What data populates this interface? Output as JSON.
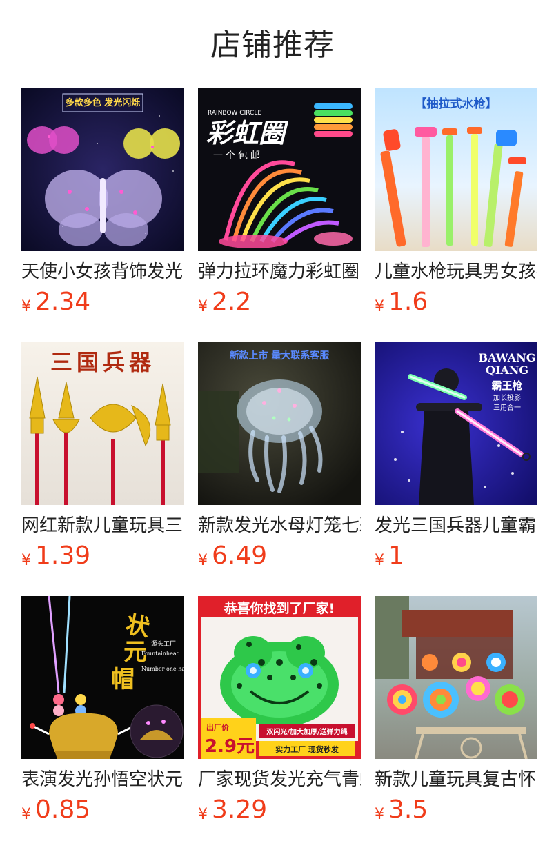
{
  "section": {
    "title": "店铺推荐"
  },
  "currency_symbol": "¥",
  "products": [
    {
      "title": "天使小女孩背饰发光蝴蝶翅膀",
      "price": "2.34",
      "image": {
        "icon": "butterfly-wings-image",
        "overlay_texts": [
          "多款多色 发光闪烁"
        ]
      }
    },
    {
      "title": "弹力拉环魔力彩虹圈",
      "price": "2.2",
      "image": {
        "icon": "rainbow-spring-image",
        "overlay_texts": [
          "RAINBOW CIRCLE",
          "彩虹圈",
          "一个包邮"
        ]
      }
    },
    {
      "title": "儿童水枪玩具男女孩抽拉式",
      "price": "1.6",
      "image": {
        "icon": "water-gun-image",
        "overlay_texts": [
          "【抽拉式水枪】"
        ]
      }
    },
    {
      "title": "网红新款儿童玩具三国兵器",
      "price": "1.39",
      "image": {
        "icon": "golden-weapons-image",
        "overlay_texts": [
          "三国兵器"
        ]
      }
    },
    {
      "title": "新款发光水母灯笼七彩",
      "price": "6.49",
      "image": {
        "icon": "jellyfish-lantern-image",
        "overlay_texts": [
          "新款上市 量大联系客服"
        ]
      }
    },
    {
      "title": "发光三国兵器儿童霸王枪",
      "price": "1",
      "image": {
        "icon": "light-sword-image",
        "overlay_texts": [
          "BAWANG",
          "QIANG",
          "霸王枪",
          "加长投影",
          "三用合一"
        ]
      }
    },
    {
      "title": "表演发光孙悟空状元帽",
      "price": "0.85",
      "image": {
        "icon": "crown-hat-image",
        "overlay_texts": [
          "状元帽",
          "源头工厂",
          "Fountainhead",
          "Number one hat"
        ]
      }
    },
    {
      "title": "厂家现货发光充气青蛙",
      "price": "3.29",
      "image": {
        "icon": "inflatable-frog-image",
        "overlay_texts": [
          "恭喜你找到了厂家!",
          "出厂价",
          "2.9元",
          "双闪光/加大加厚/送弹力绳",
          "实力工厂 现货秒发"
        ]
      }
    },
    {
      "title": "新款儿童玩具复古怀旧风车",
      "price": "3.5",
      "image": {
        "icon": "pinwheel-cart-image",
        "overlay_texts": []
      }
    }
  ],
  "colors": {
    "price": "#f03c1a",
    "title_text": "#222222",
    "background": "#ffffff"
  }
}
